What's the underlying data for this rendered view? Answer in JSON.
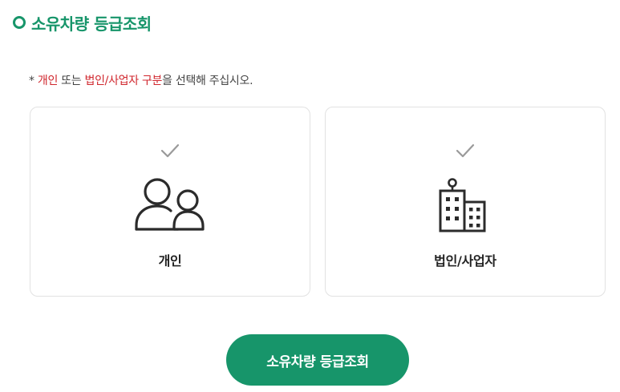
{
  "header": {
    "title": "소유차량 등급조회",
    "bullet_icon": "circle-bullet-icon"
  },
  "instruction": {
    "prefix": "* ",
    "highlight_1": "개인",
    "middle": " 또는 ",
    "highlight_2": "법인/사업자 구분",
    "suffix": "을 선택해 주십시오."
  },
  "options": [
    {
      "label": "개인",
      "icon": "people-icon",
      "check_icon": "check-icon"
    },
    {
      "label": "법인/사업자",
      "icon": "building-icon",
      "check_icon": "check-icon"
    }
  ],
  "submit": {
    "label": "소유차량 등급조회"
  },
  "colors": {
    "accent": "#17956a",
    "highlight": "#d0262d",
    "card_border": "#e2e2e2",
    "check": "#9a9a9a",
    "icon": "#2b2b2b"
  }
}
